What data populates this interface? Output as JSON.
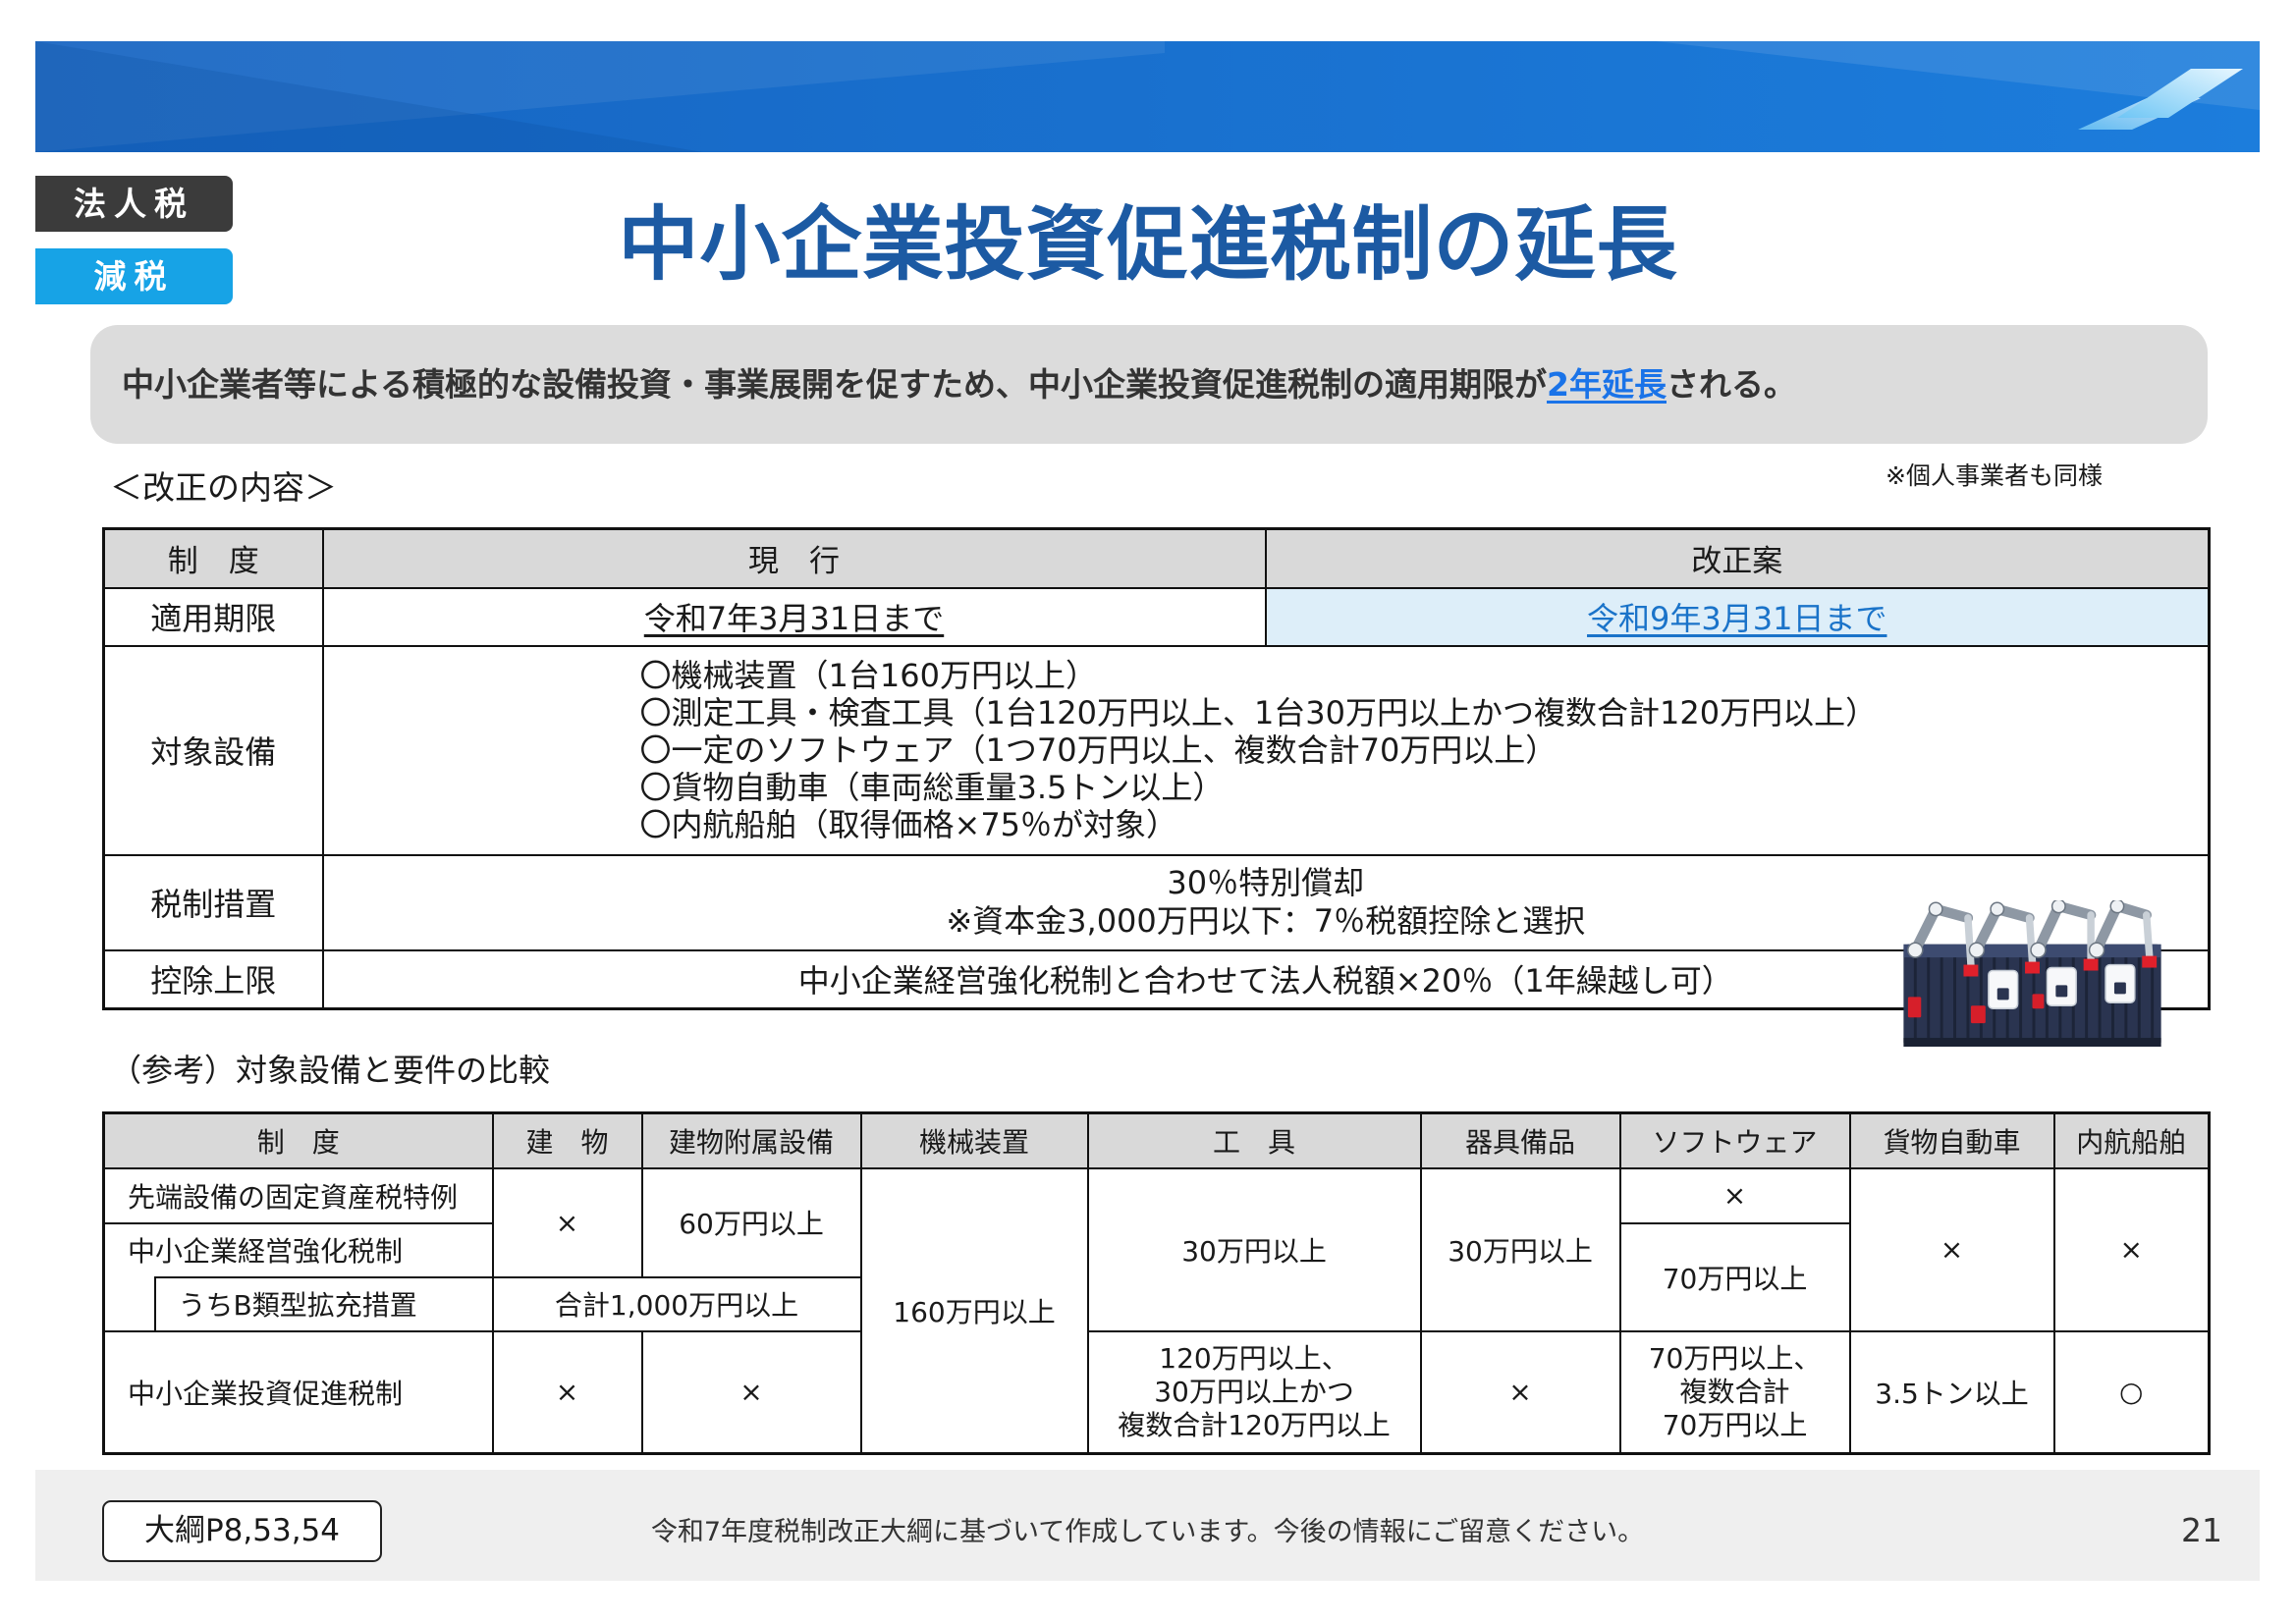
{
  "header": {
    "badge_category": "法人税",
    "badge_type": "減税",
    "title": "中小企業投資促進税制の延長"
  },
  "summary": {
    "text_before": "中小企業者等による積極的な設備投資・事業展開を促すため、中小企業投資促進税制の適用期限が",
    "highlight": "2年延長",
    "text_after": "される。"
  },
  "revision": {
    "heading": "＜改正の内容＞",
    "note": "※個人事業者も同様",
    "columns": [
      "制　度",
      "現　行",
      "改正案"
    ],
    "period": {
      "label": "適用期限",
      "current": "令和7年3月31日まで",
      "proposed": "令和9年3月31日まで"
    },
    "equipment": {
      "label": "対象設備",
      "items": [
        "〇機械装置（1台160万円以上）",
        "〇測定工具・検査工具（1台120万円以上、1台30万円以上かつ複数合計120万円以上）",
        "〇一定のソフトウェア（1つ70万円以上、複数合計70万円以上）",
        "〇貨物自動車（車両総重量3.5トン以上）",
        "〇内航船舶（取得価格×75％が対象）"
      ]
    },
    "measure": {
      "label": "税制措置",
      "lines": [
        "30％特別償却",
        "※資本金3,000万円以下：7％税額控除と選択"
      ]
    },
    "limit": {
      "label": "控除上限",
      "text": "中小企業経営強化税制と合わせて法人税額×20％（1年繰越し可）"
    }
  },
  "comparison": {
    "heading": "（参考）対象設備と要件の比較",
    "columns": [
      "制　度",
      "建　物",
      "建物附属設備",
      "機械装置",
      "工　具",
      "器具備品",
      "ソフトウェア",
      "貨物自動車",
      "内航船舶"
    ],
    "systems": [
      "先端設備の固定資産税特例",
      "中小企業経営強化税制",
      "うちB類型拡充措置",
      "中小企業投資促進税制"
    ],
    "cells": {
      "building_advanced_management": "×",
      "annex_advanced_management": "60万円以上",
      "building_annex_b_type": "合計1,000万円以上",
      "machinery_all": "160万円以上",
      "tools_others": "30万円以上",
      "fixtures_others": "30万円以上",
      "software_advanced": "×",
      "software_management": "70万円以上",
      "trucks_others": "×",
      "ships_others": "×"
    },
    "investment_promotion": {
      "building": "×",
      "building_annex": "×",
      "tools": [
        "120万円以上、",
        "30万円以上かつ",
        "複数合計120万円以上"
      ],
      "fixtures": "×",
      "software": [
        "70万円以上、",
        "複数合計",
        "70万円以上"
      ],
      "trucks": "3.5トン以上",
      "ships": "○"
    }
  },
  "footer": {
    "reference": "大綱P8,53,54",
    "disclaimer": "令和7年度税制改正大綱に基づいて作成しています。今後の情報にご留意ください。",
    "page_number": "21"
  },
  "icons": {
    "banner_logo": "brand-logo-icon",
    "illustration": "robot-arms-illustration"
  },
  "colors": {
    "title": "#1c5aa3",
    "highlight": "#1a73e8",
    "badge_dark": "#3b3b3b",
    "badge_blue": "#17a3e6",
    "banner": "#1a6fd0",
    "proposed_cell_bg": "#ddeef9",
    "table_header_bg": "#d9d9d9"
  }
}
